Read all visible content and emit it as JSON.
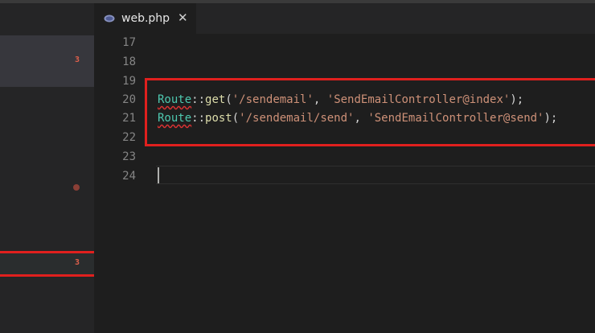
{
  "tab": {
    "title": "web.php",
    "close": "✕",
    "icon": "php-file-icon"
  },
  "sidebar": {
    "badges": [
      "3",
      "3"
    ]
  },
  "editor": {
    "line_numbers": [
      "17",
      "18",
      "19",
      "20",
      "21",
      "22",
      "23",
      "24"
    ],
    "lines": {
      "l20": {
        "class": "Route",
        "sep": "::",
        "method": "get",
        "open": "(",
        "arg1": "'/sendemail'",
        "comma": ", ",
        "arg2": "'SendEmailController@index'",
        "close": ");"
      },
      "l21": {
        "class": "Route",
        "sep": "::",
        "method": "post",
        "open": "(",
        "arg1": "'/sendemail/send'",
        "comma": ", ",
        "arg2": "'SendEmailController@send'",
        "close": ");"
      }
    }
  },
  "colors": {
    "highlight_box": "#e0201e",
    "class_token": "#4ec9b0",
    "method_token": "#dcdcaa",
    "string_token": "#ce9178",
    "badge": "#e0604c"
  }
}
